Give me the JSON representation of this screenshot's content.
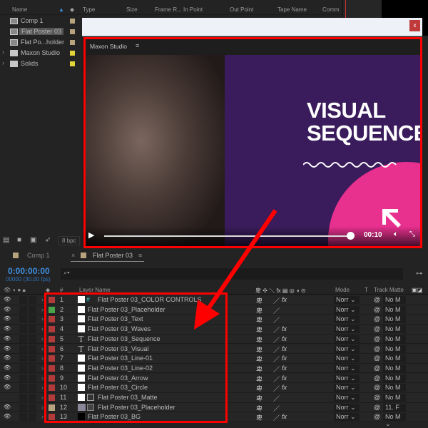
{
  "project": {
    "columns": [
      "Name",
      "Type",
      "Size",
      "Frame R...",
      "In Point",
      "Out Point",
      "Tape Name",
      "Comm"
    ],
    "items": [
      {
        "name": "Comp 1",
        "kind": "comp",
        "color": "#b7a47e"
      },
      {
        "name": "Flat Poster 03",
        "kind": "comp",
        "color": "#b7a47e"
      },
      {
        "name": "Flat Po...holder",
        "kind": "comp",
        "color": "#b7a47e"
      },
      {
        "name": "Maxon Studio",
        "kind": "folder",
        "color": "#e3d43a"
      },
      {
        "name": "Solids",
        "kind": "folder",
        "color": "#e3d43a"
      }
    ],
    "bpc": "8 bpc"
  },
  "dialog": {
    "close": "x",
    "panel_title": "Maxon Studio",
    "menu_icon": "≡",
    "video": {
      "line1": "VISUAL",
      "line2": "SEQUENCE",
      "time": "00:10",
      "progress": 0.98
    }
  },
  "timeline": {
    "tabs": [
      {
        "label": "Comp 1",
        "active": false
      },
      {
        "label": "Flat Poster 03",
        "active": true
      }
    ],
    "timecode": "0:00:00:00",
    "fps": "00000 (30.00 fps)",
    "search_placeholder": "⌕▾",
    "headers": {
      "num": "#",
      "layer_name": "Layer Name",
      "mode": "Mode",
      "t": "T",
      "track_matte": "Track Matte"
    },
    "layers": [
      {
        "n": "1",
        "name": "Flat Poster 03_COLOR CONTROLS",
        "color": "#b33a3a",
        "type": "adjust",
        "eye": true,
        "fx": true,
        "mode": "Norr",
        "matte": "No M"
      },
      {
        "n": "2",
        "name": "Flat Poster 03_Placeholder",
        "color": "#4aa54a",
        "type": "solid",
        "eye": true,
        "fx": false,
        "mode": "Norr",
        "matte": "No M"
      },
      {
        "n": "3",
        "name": "Flat Poster 03_Text",
        "color": "#b33a3a",
        "type": "solid",
        "eye": true,
        "fx": false,
        "mode": "Norr",
        "matte": "No M"
      },
      {
        "n": "4",
        "name": "Flat Poster 03_Waves",
        "color": "#b33a3a",
        "type": "solid",
        "eye": true,
        "fx": true,
        "mode": "Norr",
        "matte": "No M"
      },
      {
        "n": "5",
        "name": "Flat Poster 03_Sequence",
        "color": "#b33a3a",
        "type": "text",
        "eye": true,
        "fx": true,
        "mode": "Norr",
        "matte": "No M"
      },
      {
        "n": "6",
        "name": "Flat Poster 03_Visual",
        "color": "#b33a3a",
        "type": "text",
        "eye": true,
        "fx": true,
        "mode": "Norr",
        "matte": "No M"
      },
      {
        "n": "7",
        "name": "Flat Poster 03_Line-01",
        "color": "#b33a3a",
        "type": "solid",
        "eye": true,
        "fx": true,
        "mode": "Norr",
        "matte": "No M"
      },
      {
        "n": "8",
        "name": "Flat Poster 03_Line-02",
        "color": "#b33a3a",
        "type": "solid",
        "eye": true,
        "fx": true,
        "mode": "Norr",
        "matte": "No M"
      },
      {
        "n": "9",
        "name": "Flat Poster 03_Arrow",
        "color": "#b33a3a",
        "type": "solid",
        "eye": true,
        "fx": true,
        "mode": "Norr",
        "matte": "No M"
      },
      {
        "n": "10",
        "name": "Flat Poster 03_Circle",
        "color": "#b33a3a",
        "type": "solid",
        "eye": true,
        "fx": true,
        "mode": "Norr",
        "matte": "No M"
      },
      {
        "n": "11",
        "name": "Flat Poster 03_Matte",
        "color": "#b33a3a",
        "type": "matte",
        "eye": false,
        "fx": false,
        "mode": "Norr",
        "matte": "No M"
      },
      {
        "n": "12",
        "name": "Flat Poster 03_Placeholder",
        "color": "#b7a47e",
        "type": "comp",
        "eye": true,
        "fx": false,
        "mode": "Norr",
        "matte": "11. F"
      },
      {
        "n": "13",
        "name": "Flat Poster 03_BG",
        "color": "#b33a3a",
        "type": "black",
        "eye": true,
        "fx": true,
        "mode": "Norr",
        "matte": "No M"
      }
    ]
  }
}
